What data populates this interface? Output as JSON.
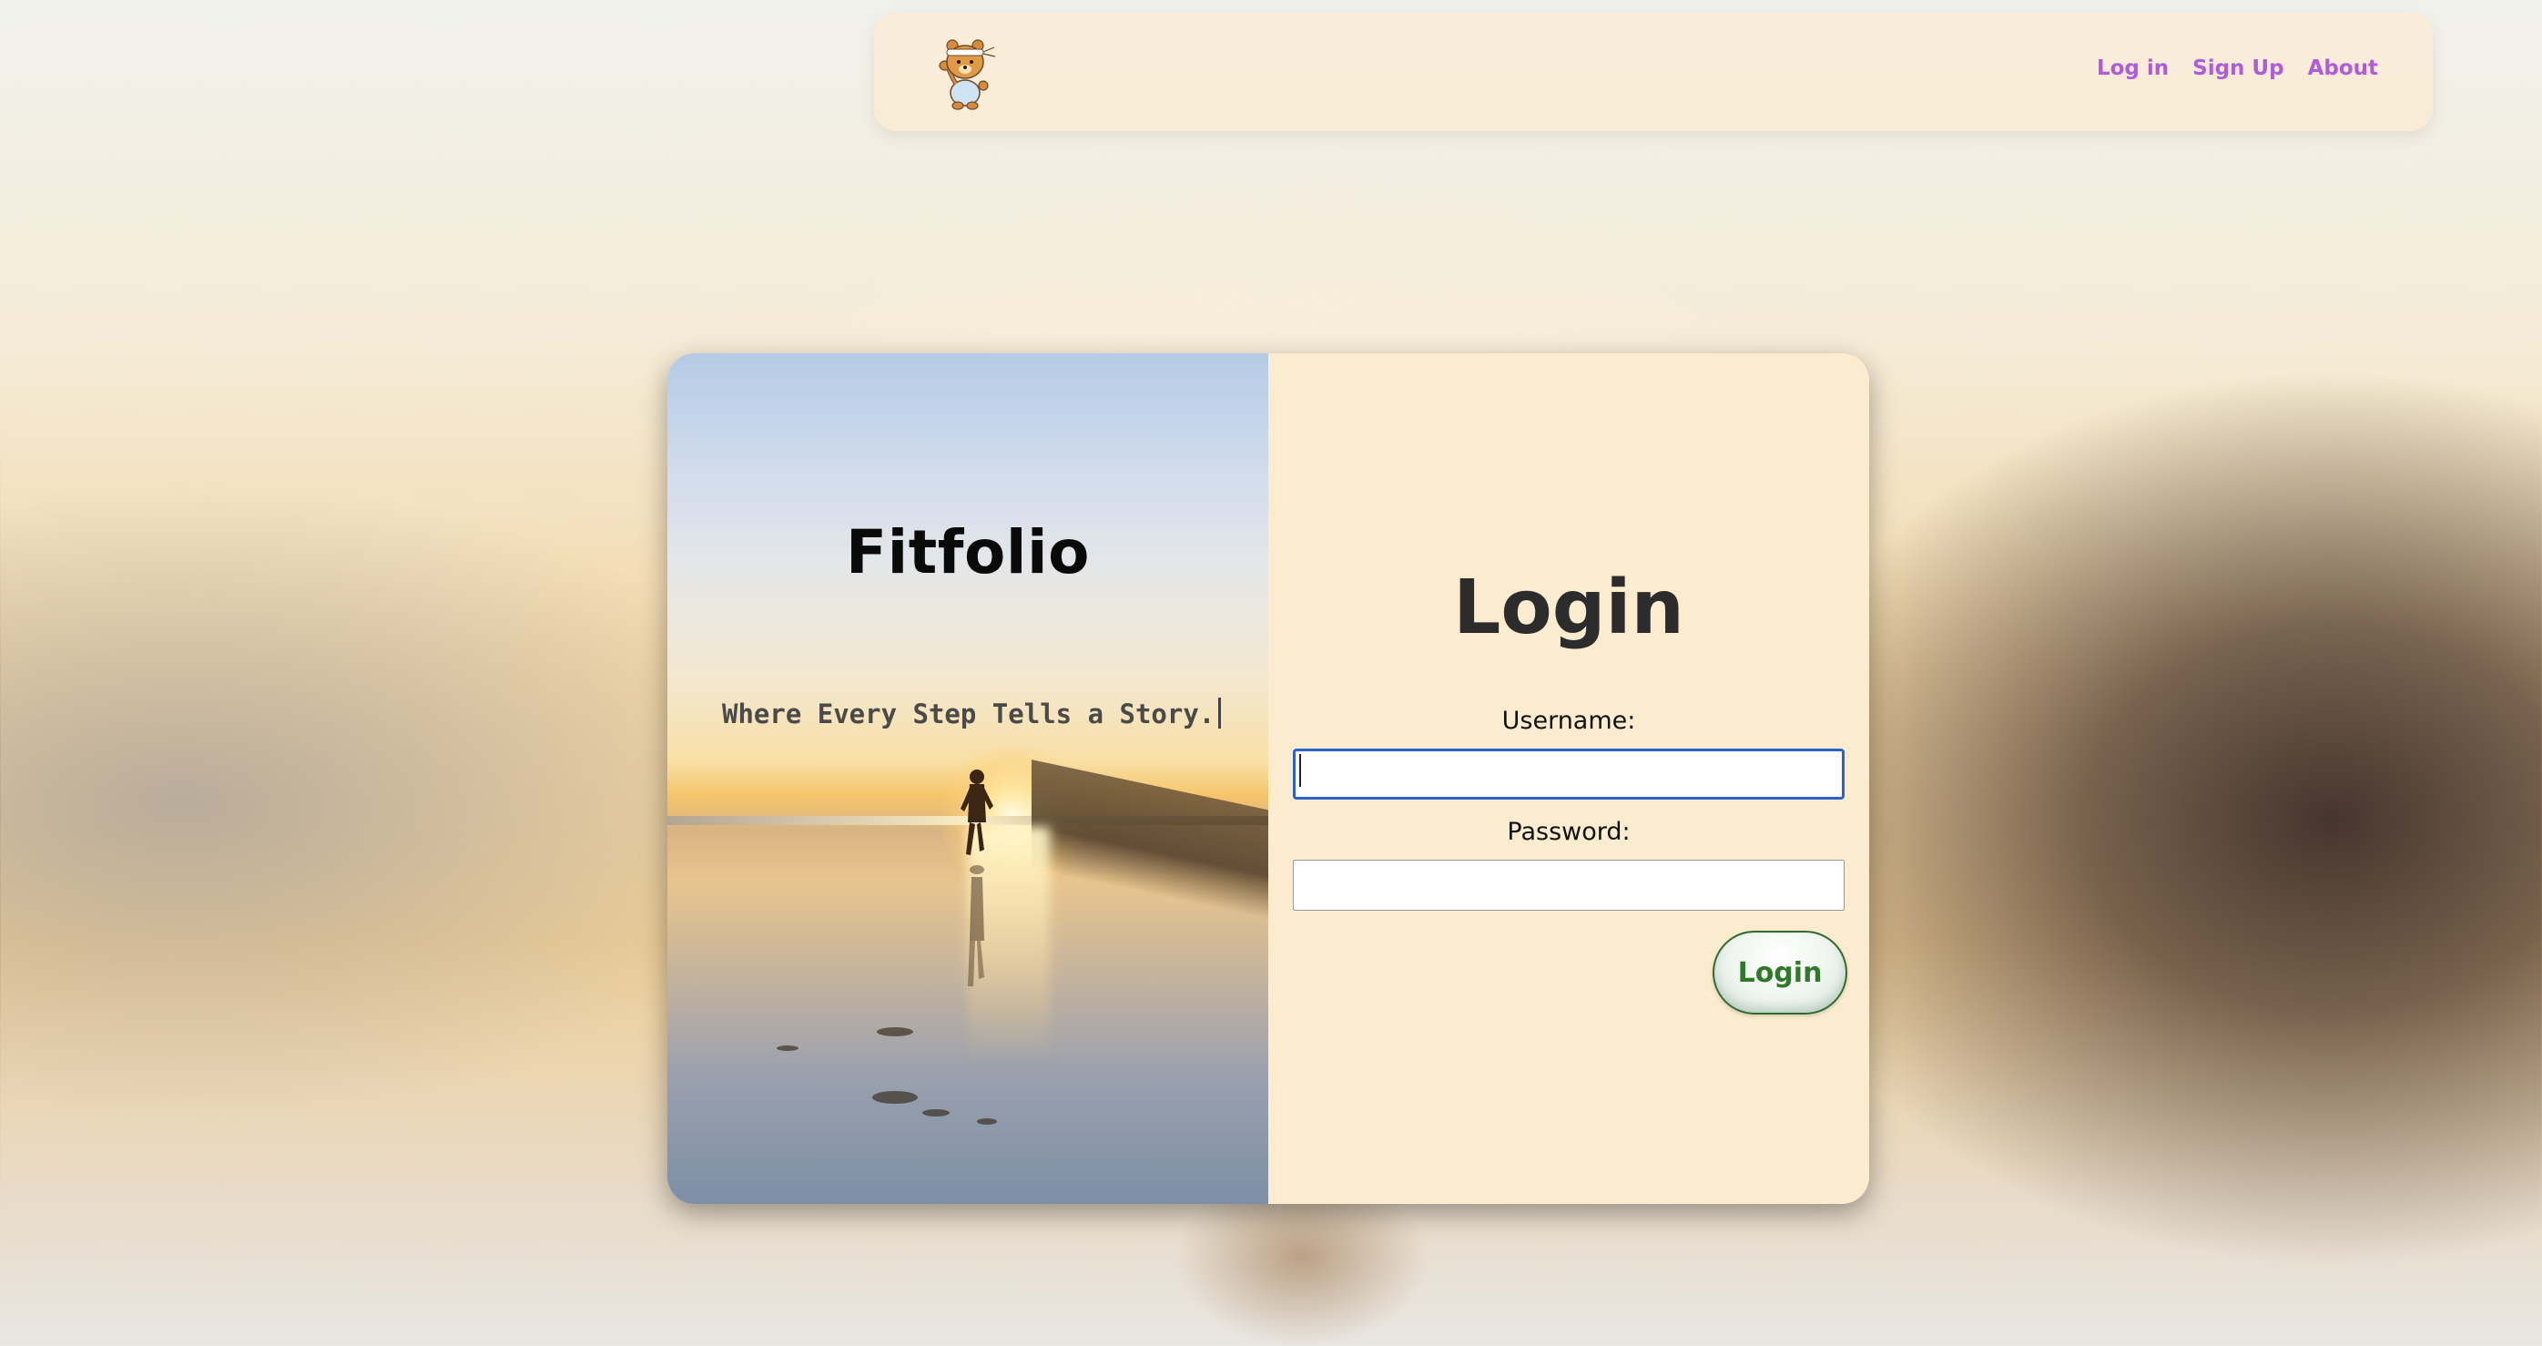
{
  "navbar": {
    "logo_icon": "bear-mascot-icon",
    "links": [
      {
        "label": "Log in"
      },
      {
        "label": "Sign Up"
      },
      {
        "label": "About"
      }
    ],
    "link_color": "#b05bd8"
  },
  "hero": {
    "title": "Fitfolio",
    "tagline": "Where Every Step Tells a Story."
  },
  "login_form": {
    "title": "Login",
    "username_label": "Username:",
    "username_value": "",
    "password_label": "Password:",
    "password_value": "",
    "submit_label": "Login",
    "accent_color": "#2f7a2a",
    "focus_color": "#2f62c9"
  }
}
